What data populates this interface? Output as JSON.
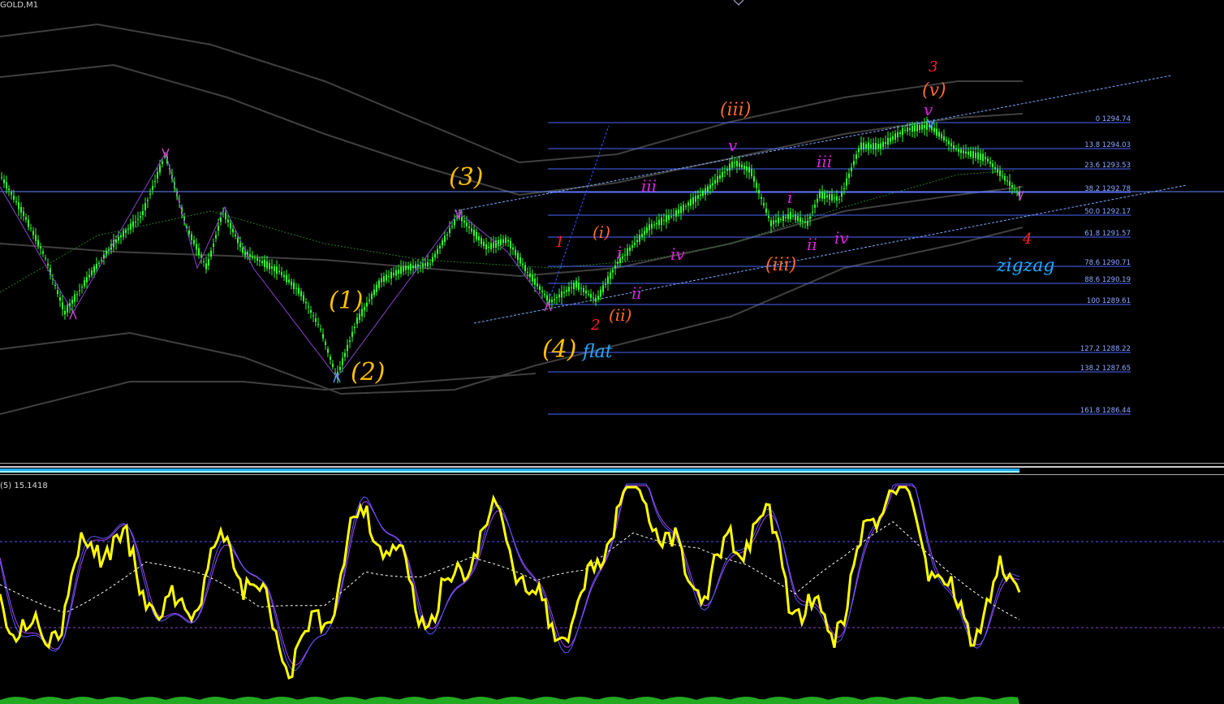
{
  "window": {
    "symbol_label": "GOLD,M1"
  },
  "indicator": {
    "label": "(5) 15.1418"
  },
  "colors": {
    "background": "#000000",
    "candle": "#32ff32",
    "fib_line": "#4a66ff",
    "fib_text": "#8fa8ff",
    "indicator_main": "#ffff00",
    "indicator_signal": "#5555ff",
    "indicator_signal2": "#aa44ff",
    "indicator_ma": "#ffffff",
    "wave_orange": "#ffc000",
    "wave_red": "#ff2020",
    "wave_orangered": "#ff6a28",
    "wave_magenta": "#e020e0",
    "wave_blue": "#1eaaff",
    "channel": "#7ea8ff",
    "envelope": "#404040",
    "ma_green": "#2a7a2a"
  },
  "fibonacci": [
    {
      "level": "0",
      "price": "1294.74"
    },
    {
      "level": "13.8",
      "price": "1294.03"
    },
    {
      "level": "23.6",
      "price": "1293.53"
    },
    {
      "level": "38.2",
      "price": "1292.78"
    },
    {
      "level": "50.0",
      "price": "1292.17"
    },
    {
      "level": "61.8",
      "price": "1291.57"
    },
    {
      "level": "78.6",
      "price": "1290.71"
    },
    {
      "level": "88.6",
      "price": "1290.19"
    },
    {
      "level": "100",
      "price": "1289.61"
    },
    {
      "level": "127.2",
      "price": "1288.22"
    },
    {
      "level": "138.2",
      "price": "1287.65"
    },
    {
      "level": "161.8",
      "price": "1286.44"
    }
  ],
  "waves": {
    "w1p": "(1)",
    "w2p": "(2)",
    "w3p": "(3)",
    "w4p": "(4)",
    "flat": "flat",
    "zigzag": "zigzag",
    "r1": "1",
    "r2": "2",
    "r3": "3",
    "r4": "4",
    "o_i": "(i)",
    "o_ii": "(ii)",
    "o_iii": "(iii)",
    "o_iii2": "(iii)",
    "o_v": "(v)",
    "m_i": "i",
    "m_ii": "ii",
    "m_iii": "iii",
    "m_iv": "iv",
    "m_v": "v",
    "m_i2": "i",
    "m_ii2": "ii",
    "m_iii2": "iii",
    "m_iv2": "iv",
    "m_v2": "v"
  }
}
